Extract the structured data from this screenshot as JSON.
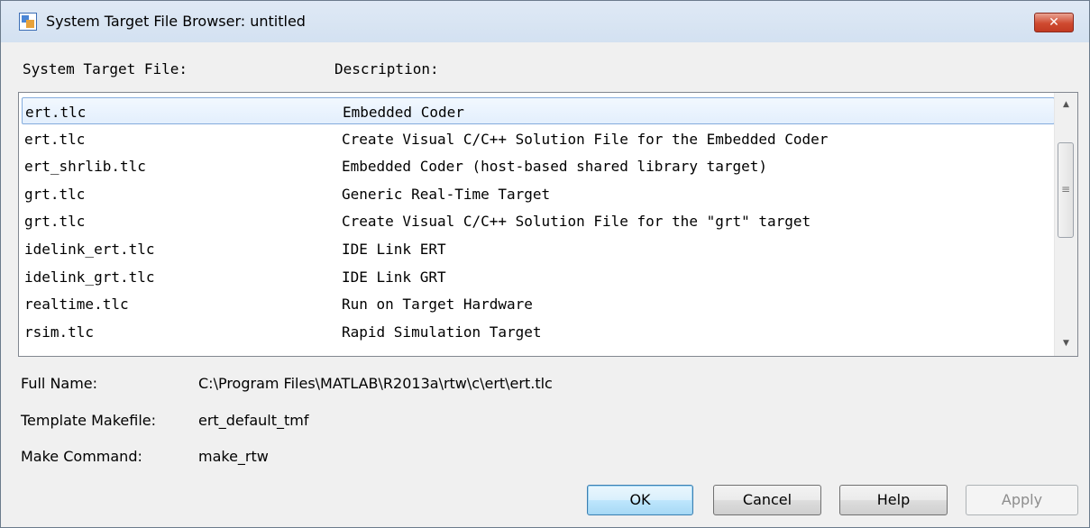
{
  "window": {
    "title": "System Target File Browser: untitled",
    "close_glyph": "✕"
  },
  "columns": {
    "file": "System Target File:",
    "description": "Description:"
  },
  "targets": [
    {
      "file": "ert.tlc",
      "description": "Embedded Coder",
      "selected": true
    },
    {
      "file": "ert.tlc",
      "description": "Create Visual C/C++ Solution File for the Embedded Coder",
      "selected": false
    },
    {
      "file": "ert_shrlib.tlc",
      "description": "Embedded Coder (host-based shared library target)",
      "selected": false
    },
    {
      "file": "grt.tlc",
      "description": "Generic Real-Time Target",
      "selected": false
    },
    {
      "file": "grt.tlc",
      "description": "Create Visual C/C++ Solution File for the \"grt\" target",
      "selected": false
    },
    {
      "file": "idelink_ert.tlc",
      "description": "IDE Link ERT",
      "selected": false
    },
    {
      "file": "idelink_grt.tlc",
      "description": "IDE Link GRT",
      "selected": false
    },
    {
      "file": "realtime.tlc",
      "description": "Run on Target Hardware",
      "selected": false
    },
    {
      "file": "rsim.tlc",
      "description": "Rapid Simulation Target",
      "selected": false
    }
  ],
  "scrollbar": {
    "up_glyph": "▲",
    "down_glyph": "▼",
    "grip_glyph": "≡"
  },
  "details": {
    "full_name_label": "Full Name:",
    "full_name_value": "C:\\Program Files\\MATLAB\\R2013a\\rtw\\c\\ert\\ert.tlc",
    "template_makefile_label": "Template Makefile:",
    "template_makefile_value": "ert_default_tmf",
    "make_command_label": "Make Command:",
    "make_command_value": "make_rtw"
  },
  "buttons": {
    "ok": "OK",
    "cancel": "Cancel",
    "help": "Help",
    "apply": "Apply"
  },
  "colors": {
    "selection_border": "#84acdd",
    "default_button_border": "#3c7fb1",
    "close_button": "#cf4a30"
  }
}
